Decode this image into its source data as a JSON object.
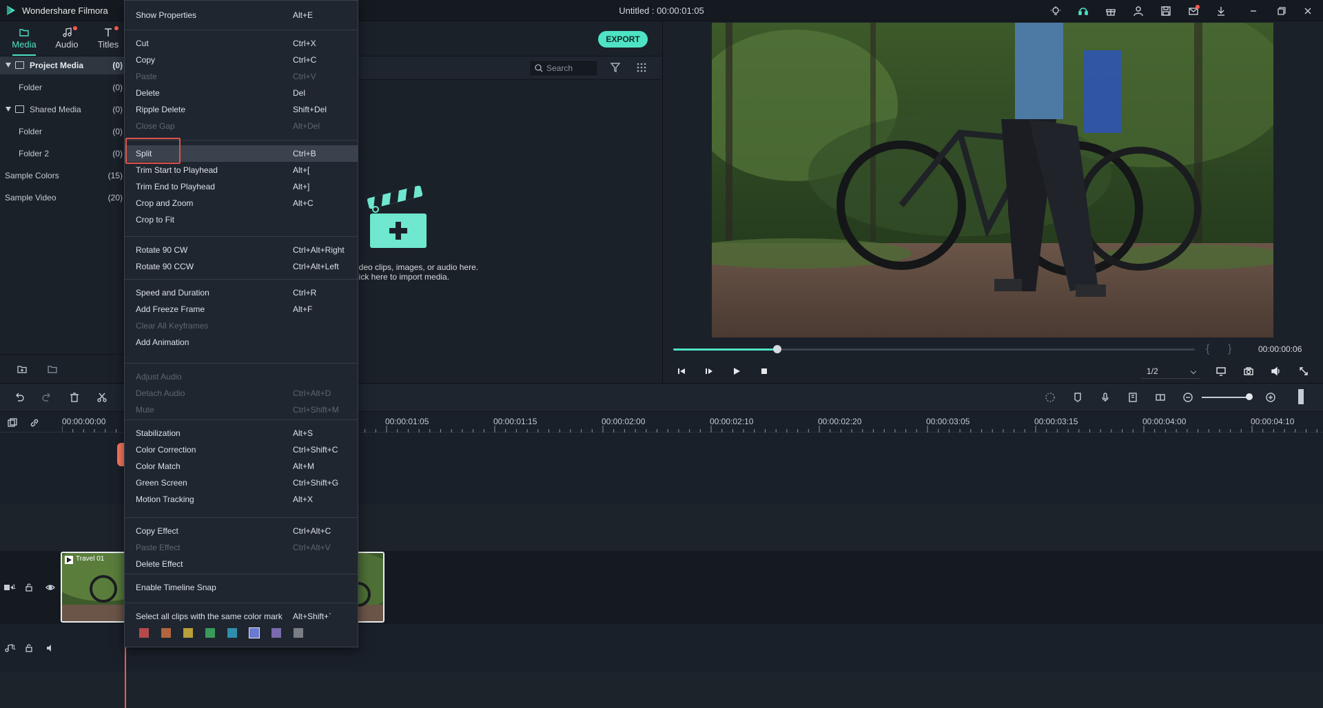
{
  "app": {
    "name": "Wondershare Filmora",
    "document_title": "Untitled : 00:00:01:05"
  },
  "titlebar": {
    "icons": [
      "lightbulb-icon",
      "headset-icon",
      "gift-icon",
      "account-icon",
      "save-icon",
      "mail-icon",
      "download-icon",
      "minimize-icon",
      "restore-icon",
      "close-icon"
    ]
  },
  "media_tabs": [
    {
      "label": "Media",
      "icon": "folder-icon",
      "active": true
    },
    {
      "label": "Audio",
      "icon": "music-note-icon",
      "badge": true
    },
    {
      "label": "Titles",
      "icon": "text-icon",
      "badge": true
    }
  ],
  "library": [
    {
      "label": "Project Media",
      "count": "(0)"
    },
    {
      "label": "Folder",
      "count": "(0)"
    },
    {
      "label": "Shared Media",
      "count": "(0)"
    },
    {
      "label": "Folder",
      "count": "(0)"
    },
    {
      "label": "Folder 2",
      "count": "(0)"
    },
    {
      "label": "Sample Colors",
      "count": "(15)"
    },
    {
      "label": "Sample Video",
      "count": "(20)"
    }
  ],
  "media_toolbar": {
    "export_label": "EXPORT"
  },
  "search": {
    "placeholder": "Search"
  },
  "import_hint": {
    "line1": "ideo clips, images, or audio here.",
    "line2": "lick here to import media."
  },
  "preview": {
    "time": "00:00:00:06",
    "progress": 0.2,
    "quality": "1/2",
    "mark_in": "{",
    "mark_out": "}"
  },
  "timeline": {
    "ruler_labels": [
      "00:00:00:00",
      "00:00:01:05",
      "00:00:01:15",
      "00:00:02:00",
      "00:00:02:10",
      "00:00:02:20",
      "00:00:03:05",
      "00:00:03:15",
      "00:00:04:00",
      "00:00:04:10"
    ],
    "clip_label": "Travel 01",
    "video_track": "1",
    "audio_track": "1",
    "zoom": 0.9
  },
  "context_menu": {
    "groups": [
      [
        {
          "label": "Show Properties",
          "shortcut": "Alt+E",
          "enabled": true
        }
      ],
      [
        {
          "label": "Cut",
          "shortcut": "Ctrl+X",
          "enabled": true
        },
        {
          "label": "Copy",
          "shortcut": "Ctrl+C",
          "enabled": true
        },
        {
          "label": "Paste",
          "shortcut": "Ctrl+V",
          "enabled": false
        },
        {
          "label": "Delete",
          "shortcut": "Del",
          "enabled": true
        },
        {
          "label": "Ripple Delete",
          "shortcut": "Shift+Del",
          "enabled": true
        },
        {
          "label": "Close Gap",
          "shortcut": "Alt+Del",
          "enabled": false
        }
      ],
      [
        {
          "label": "Split",
          "shortcut": "Ctrl+B",
          "enabled": true,
          "highlighted": true
        },
        {
          "label": "Trim Start to Playhead",
          "shortcut": "Alt+[",
          "enabled": true
        },
        {
          "label": "Trim End to Playhead",
          "shortcut": "Alt+]",
          "enabled": true
        },
        {
          "label": "Crop and Zoom",
          "shortcut": "Alt+C",
          "enabled": true
        },
        {
          "label": "Crop to Fit",
          "shortcut": "",
          "enabled": true
        }
      ],
      [
        {
          "label": "Rotate 90 CW",
          "shortcut": "Ctrl+Alt+Right",
          "enabled": true
        },
        {
          "label": "Rotate 90 CCW",
          "shortcut": "Ctrl+Alt+Left",
          "enabled": true
        }
      ],
      [
        {
          "label": "Speed and Duration",
          "shortcut": "Ctrl+R",
          "enabled": true
        },
        {
          "label": "Add Freeze Frame",
          "shortcut": "Alt+F",
          "enabled": true
        },
        {
          "label": "Clear All Keyframes",
          "shortcut": "",
          "enabled": false
        },
        {
          "label": "Add Animation",
          "shortcut": "",
          "enabled": true
        }
      ],
      [
        {
          "label": "Adjust Audio",
          "shortcut": "",
          "enabled": false
        },
        {
          "label": "Detach Audio",
          "shortcut": "Ctrl+Alt+D",
          "enabled": false
        },
        {
          "label": "Mute",
          "shortcut": "Ctrl+Shift+M",
          "enabled": false
        }
      ],
      [
        {
          "label": "Stabilization",
          "shortcut": "Alt+S",
          "enabled": true
        },
        {
          "label": "Color Correction",
          "shortcut": "Ctrl+Shift+C",
          "enabled": true
        },
        {
          "label": "Color Match",
          "shortcut": "Alt+M",
          "enabled": true
        },
        {
          "label": "Green Screen",
          "shortcut": "Ctrl+Shift+G",
          "enabled": true
        },
        {
          "label": "Motion Tracking",
          "shortcut": "Alt+X",
          "enabled": true
        }
      ],
      [
        {
          "label": "Copy Effect",
          "shortcut": "Ctrl+Alt+C",
          "enabled": true
        },
        {
          "label": "Paste Effect",
          "shortcut": "Ctrl+Alt+V",
          "enabled": false
        },
        {
          "label": "Delete Effect",
          "shortcut": "",
          "enabled": true
        }
      ],
      [
        {
          "label": "Enable Timeline Snap",
          "shortcut": "",
          "enabled": true
        }
      ],
      [
        {
          "label": "Select all clips with the same color mark",
          "shortcut": "Alt+Shift+`",
          "enabled": true
        }
      ]
    ],
    "color_marks": [
      "#b54a4a",
      "#b3653f",
      "#b8a03a",
      "#3a9a5a",
      "#2f8eae",
      "#6a7ad0",
      "#7b6aae",
      "#7a7e84"
    ],
    "selected_color_mark": 5
  },
  "colors": {
    "accent": "#4ee3c5",
    "playhead": "#ff5a4e",
    "highlight_box": "#e0524a"
  }
}
